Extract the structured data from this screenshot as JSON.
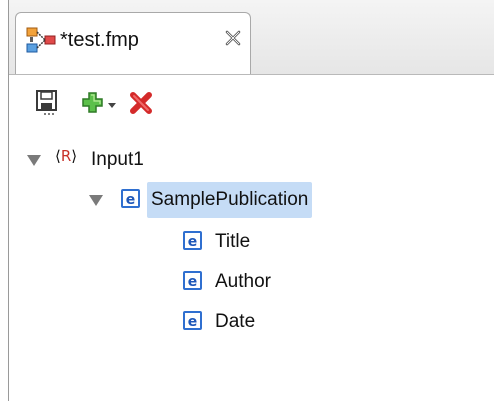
{
  "tab": {
    "title": "*test.fmp",
    "icon": "mapping-editor-icon",
    "close_icon": "close-icon"
  },
  "toolbar": {
    "save_icon": "save-icon",
    "add_icon": "add-icon",
    "add_dropdown_icon": "chevron-down-icon",
    "delete_icon": "delete-icon"
  },
  "tree": {
    "root": {
      "label": "Input1",
      "icon_text": "<R>",
      "icon_letter": "R",
      "expanded": true
    },
    "items": [
      {
        "label": "SamplePublication",
        "icon_text": "e",
        "expanded": true,
        "selected": true
      },
      {
        "label": "Title",
        "icon_text": "e"
      },
      {
        "label": "Author",
        "icon_text": "e"
      },
      {
        "label": "Date",
        "icon_text": "e"
      }
    ]
  },
  "colors": {
    "selection": "#c5dcf6",
    "element_icon_border": "#2f6fd0",
    "delete": "#d42a2a",
    "add": "#3aa836"
  }
}
